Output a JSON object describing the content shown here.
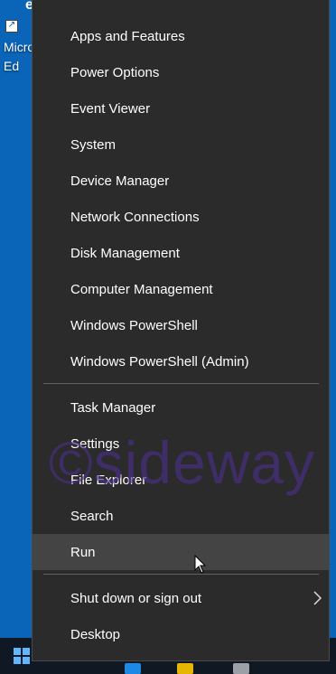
{
  "desktop": {
    "icon_label": "Micro\nEd"
  },
  "menu": {
    "group1": [
      "Apps and Features",
      "Power Options",
      "Event Viewer",
      "System",
      "Device Manager",
      "Network Connections",
      "Disk Management",
      "Computer Management",
      "Windows PowerShell",
      "Windows PowerShell (Admin)"
    ],
    "group2": [
      "Task Manager",
      "Settings",
      "File Explorer",
      "Search",
      "Run"
    ],
    "group3": [
      "Shut down or sign out",
      "Desktop"
    ],
    "active_item": "Run"
  },
  "watermark": "©sideway",
  "colors": {
    "desktop_bg": "#0a64b8",
    "menu_bg": "#2b2b2b",
    "menu_hover": "#444444",
    "taskbar_bg": "#101923",
    "accent": "#5fb8ff"
  }
}
